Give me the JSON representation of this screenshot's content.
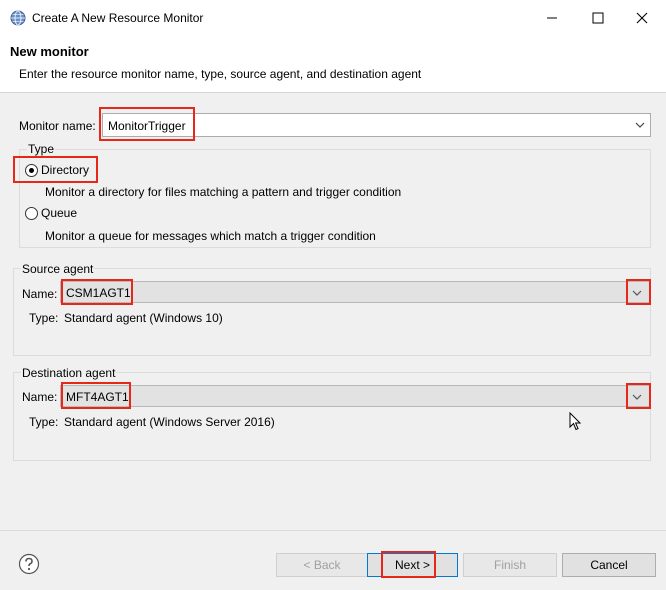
{
  "window": {
    "title": "Create A New Resource Monitor",
    "app_icon": "globe-icon"
  },
  "banner": {
    "title": "New monitor",
    "description": "Enter the resource monitor name, type, source agent, and destination agent"
  },
  "monitor_name": {
    "label": "Monitor name:",
    "value": "MonitorTrigger"
  },
  "type_group": {
    "legend": "Type",
    "options": [
      {
        "label": "Directory",
        "selected": true,
        "description": "Monitor a directory for files matching a pattern and trigger condition"
      },
      {
        "label": "Queue",
        "selected": false,
        "description": "Monitor a queue for messages which match a trigger condition"
      }
    ]
  },
  "source_agent": {
    "legend": "Source agent",
    "name_label": "Name:",
    "name_value": "CSM1AGT1",
    "type_label": "Type:",
    "type_value": "Standard agent (Windows 10)"
  },
  "destination_agent": {
    "legend": "Destination agent",
    "name_label": "Name:",
    "name_value": "MFT4AGT1",
    "type_label": "Type:",
    "type_value": "Standard agent (Windows Server 2016)"
  },
  "footer": {
    "help_icon": "help-icon",
    "back_label": "< Back",
    "next_label": "Next >",
    "finish_label": "Finish",
    "cancel_label": "Cancel"
  },
  "colors": {
    "highlight": "#e8271b",
    "accent": "#0078d7"
  }
}
